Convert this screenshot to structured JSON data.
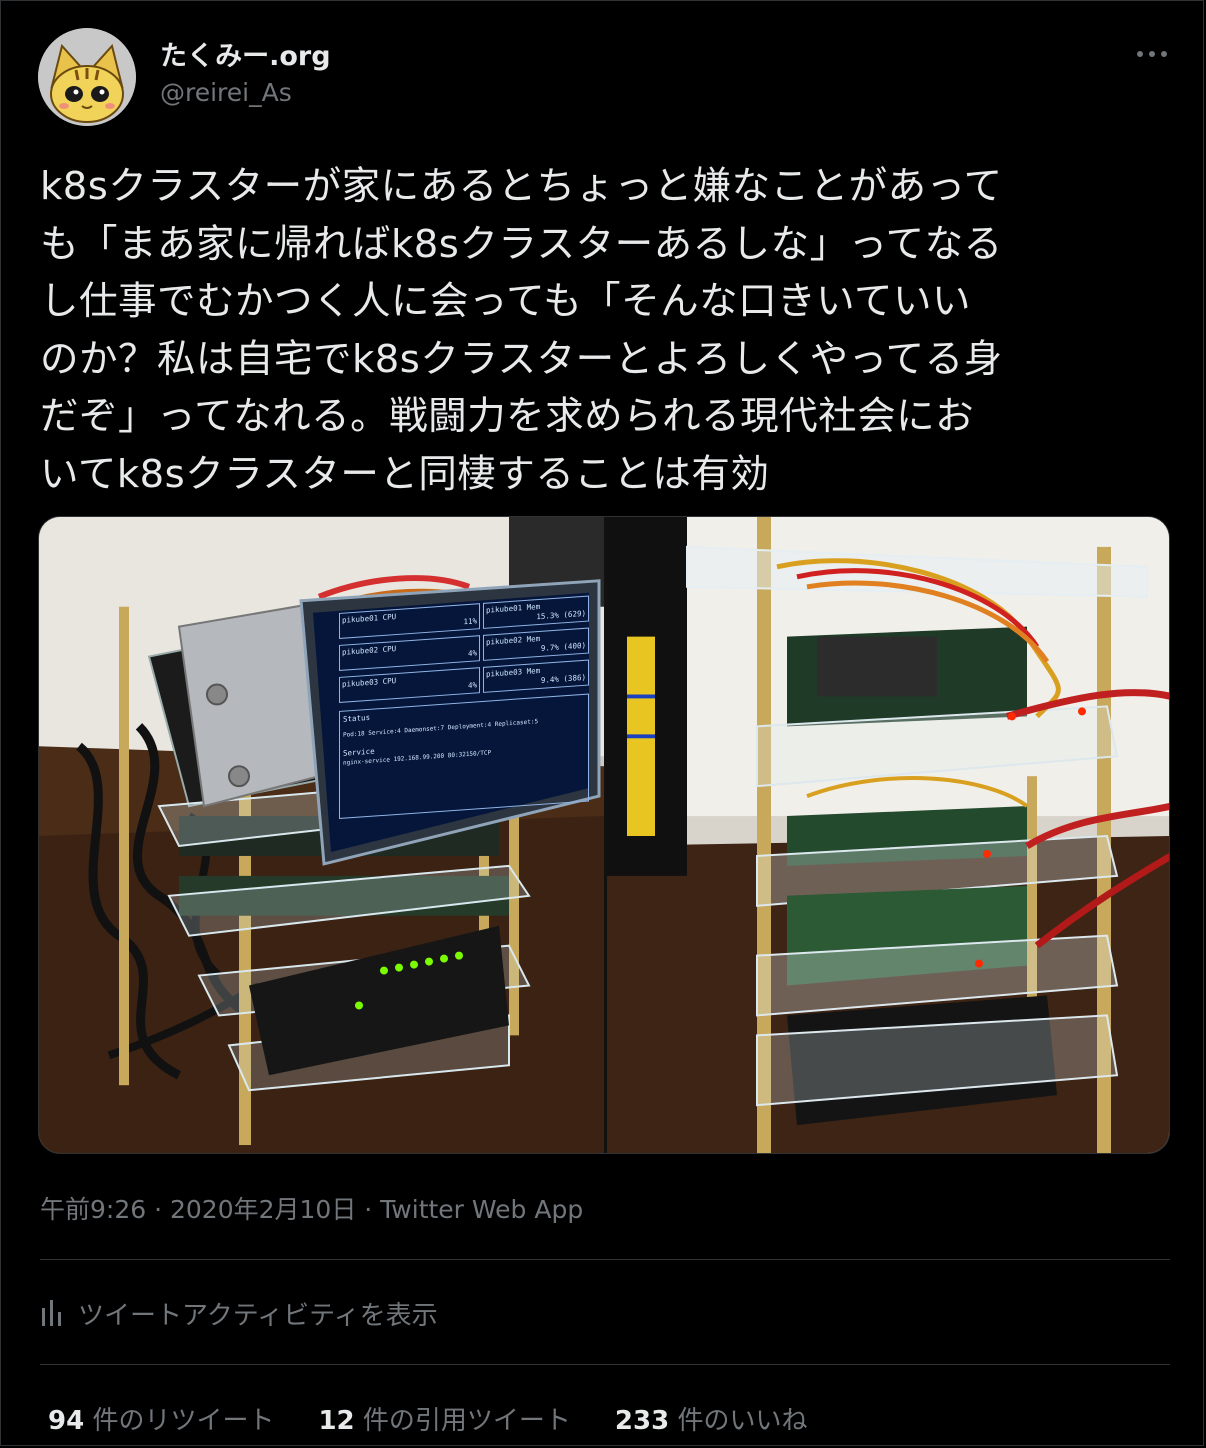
{
  "user": {
    "display_name": "たくみー.org",
    "handle": "@reirei_As",
    "avatar_icon": "cat-avatar-icon"
  },
  "tweet": {
    "text": "k8sクラスターが家にあるとちょっと嫌なことがあって\nも「まあ家に帰ればk8sクラスターあるしな」ってなる\nし仕事でむかつく人に会っても「そんな口きいていい\nのか？私は自宅でk8sクラスターとよろしくやってる身\nだぞ」ってなれる。戦闘力を求められる現代社会にお\nいてk8sクラスターと同棲することは有効"
  },
  "media": {
    "photos": [
      {
        "subject": "raspberry-pi-cluster-with-display",
        "screen": {
          "cpu1_label": "pikube01 CPU",
          "cpu1_value": "11%",
          "mem1_label": "pikube01 Mem",
          "mem1_value": "15.3% (629)",
          "cpu2_label": "pikube02 CPU",
          "cpu2_value": "4%",
          "mem2_label": "pikube02 Mem",
          "mem2_value": "9.7% (400)",
          "cpu3_label": "pikube03 CPU",
          "cpu3_value": "4%",
          "mem3_label": "pikube03 Mem",
          "mem3_value": "9.4% (386)",
          "status_title": "Status",
          "status_line": "Pod:18 Service:4 Daemonset:7 Deployment:4 Replicaset:5",
          "service_label": "Service",
          "service_line": "nginx-service  192.168.99.200  80:32150/TCP"
        }
      },
      {
        "subject": "raspberry-pi-cluster-side-view"
      }
    ]
  },
  "meta": {
    "time": "午前9:26",
    "sep": " · ",
    "date": "2020年2月10日",
    "client": "Twitter Web App"
  },
  "activity": {
    "label": "ツイートアクティビティを表示",
    "icon": "analytics-bar-icon"
  },
  "stats": {
    "retweets": "94",
    "retweets_label": " 件のリツイート",
    "quotes": "12",
    "quotes_label": " 件の引用ツイート",
    "likes": "233",
    "likes_label": " 件のいいね"
  },
  "colors": {
    "background": "#000000",
    "primary_text": "#e7e9ea",
    "secondary_text": "#71767b",
    "border": "#2f3336",
    "screen_text": "#cfe6ff",
    "led_green": "#7CFC00",
    "led_red": "#ff2a00"
  }
}
